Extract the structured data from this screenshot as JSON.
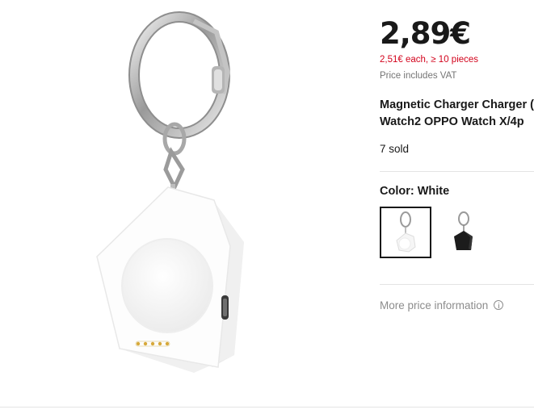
{
  "product": {
    "price": "2,89€",
    "bulk_price": "2,51€ each, ≥ 10 pieces",
    "vat_note": "Price includes VAT",
    "title_line1": "Magnetic Charger Charger (",
    "title_line2": "Watch2 OPPO Watch X/4p",
    "sold": "7 sold",
    "color_label": "Color:",
    "color_value": "White",
    "swatches": [
      {
        "name": "White",
        "selected": true
      },
      {
        "name": "Black",
        "selected": false
      }
    ],
    "more_price_info": "More price information"
  },
  "colors": {
    "text": "#191919",
    "discount_red": "#d3031c",
    "muted": "#757575",
    "selected_border": "#191919"
  }
}
